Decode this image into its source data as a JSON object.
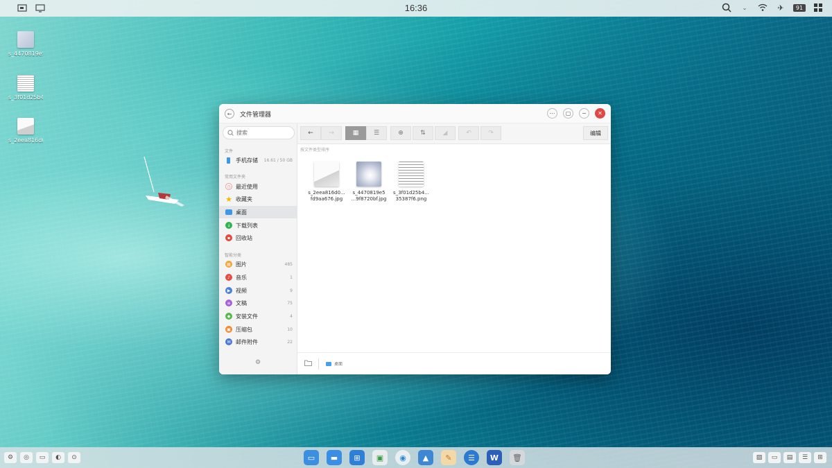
{
  "topbar": {
    "time": "16:36",
    "battery": "91",
    "left_icons": [
      "screenshot-icon",
      "monitor-icon"
    ],
    "right_icons": [
      "search-icon",
      "dropdown-chevron-icon",
      "wifi-icon",
      "airplane-icon",
      "battery-icon",
      "grid-icon"
    ]
  },
  "desktop": {
    "icons": [
      {
        "label": "s_4470819e5"
      },
      {
        "label": "s_3f01d25b4"
      },
      {
        "label": "s_2eea816d0"
      }
    ]
  },
  "window": {
    "title": "文件管理器",
    "controls": [
      "more-icon",
      "restore-icon",
      "minimize-icon",
      "close-icon"
    ]
  },
  "sidebar": {
    "search_placeholder": "搜索",
    "sections": {
      "files": "文件",
      "common": "常用文件夹",
      "smart": "智能分类"
    },
    "storage": {
      "label": "手机存储",
      "value": "16.61 / 50 GB"
    },
    "common_items": [
      {
        "label": "最近使用",
        "color": "#ffffff",
        "icon": "clock-icon"
      },
      {
        "label": "收藏夹",
        "color": "#f5b800",
        "icon": "star-icon"
      },
      {
        "label": "桌面",
        "color": "#3d97e6",
        "icon": "desktop-folder-icon"
      },
      {
        "label": "下载列表",
        "color": "#2fb44f",
        "icon": "download-icon"
      },
      {
        "label": "回收站",
        "color": "#e24b3c",
        "icon": "trash-icon"
      }
    ],
    "smart_items": [
      {
        "label": "图片",
        "count": "485",
        "color": "#f1a43a",
        "icon": "image-icon"
      },
      {
        "label": "音乐",
        "count": "1",
        "color": "#e84b44",
        "icon": "music-icon"
      },
      {
        "label": "视频",
        "count": "9",
        "color": "#4e7fd9",
        "icon": "video-icon"
      },
      {
        "label": "文稿",
        "count": "75",
        "color": "#a460d8",
        "icon": "document-icon"
      },
      {
        "label": "安装文件",
        "count": "4",
        "color": "#57b94c",
        "icon": "package-icon"
      },
      {
        "label": "压缩包",
        "count": "10",
        "color": "#f08a31",
        "icon": "archive-icon"
      },
      {
        "label": "邮件附件",
        "count": "22",
        "color": "#4b78d8",
        "icon": "mail-icon"
      }
    ]
  },
  "toolbar": {
    "back": "←",
    "forward": "→",
    "grid_view": "▦",
    "list_view": "☰",
    "new_folder": "⊕",
    "sort": "⇅",
    "clean": "◢",
    "undo": "↶",
    "redo": "↷",
    "edit_label": "编辑"
  },
  "content": {
    "sort_label": "按文件类型排序",
    "files": [
      {
        "line1": "s_2eea816d0...",
        "line2": "fd9aa676.jpg"
      },
      {
        "line1": "s_4470819e5",
        "line2": "...9f8720bf.jpg"
      },
      {
        "line1": "s_3f01d25b4...",
        "line2": "35387f6.png"
      }
    ]
  },
  "statusbar": {
    "path": "桌面"
  },
  "dock": {
    "left_icons": [
      "settings-icon",
      "browser-icon",
      "screen-icon",
      "toggle-icon",
      "record-icon"
    ],
    "apps": [
      {
        "name": "desktop-app-icon",
        "color": "#3b8ee0"
      },
      {
        "name": "file-manager-icon",
        "color": "#3a8ee6"
      },
      {
        "name": "app-grid-icon",
        "color": "#2f7fd8"
      },
      {
        "name": "image-viewer-icon",
        "color": "#e8ecec"
      },
      {
        "name": "browser-app-icon",
        "color": "#e9eef2"
      },
      {
        "name": "photo-app-icon",
        "color": "#3d87d4"
      },
      {
        "name": "notes-app-icon",
        "color": "#f3d8a8"
      },
      {
        "name": "chat-app-icon",
        "color": "#2b79d0"
      },
      {
        "name": "word-app-icon",
        "color": "#2b5fb8"
      },
      {
        "name": "trash-app-icon",
        "color": "#d4d8da"
      }
    ],
    "right_icons": [
      "picture-icon",
      "folder-icon",
      "document-icon",
      "list-icon",
      "grid-icon"
    ]
  }
}
